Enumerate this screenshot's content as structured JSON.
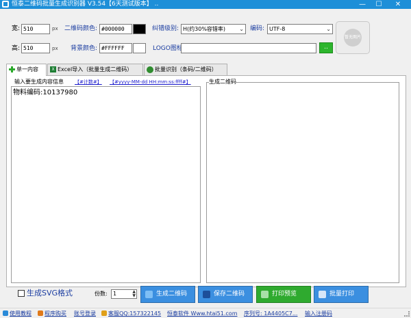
{
  "window": {
    "title": "恒泰二维码批量生成识别器 V3.54【6天测试版本】",
    "title_suffix": "..",
    "minimize": "—",
    "maximize": "☐",
    "close": "✕"
  },
  "settings": {
    "width_label": "宽:",
    "width_value": "510",
    "height_label": "高:",
    "height_value": "510",
    "unit": "px",
    "qr_color_label": "二维码颜色:",
    "qr_color_value": "#000000",
    "qr_color_swatch": "#000000",
    "bg_color_label": "背景颜色:",
    "bg_color_value": "#FFFFFF",
    "bg_color_swatch": "#FFFFFF",
    "ecc_label": "纠错级别:",
    "ecc_value": "H(约30%容错率)",
    "encoding_label": "编码:",
    "encoding_value": "UTF-8",
    "logo_label": "LOGO图标:",
    "logo_path": "",
    "browse_label": "..",
    "logo_placeholder": "暂无图片"
  },
  "tabs": [
    {
      "label": "单一内容",
      "icon": "plus-icon"
    },
    {
      "label": "Excel导入（批量生成二维码）",
      "icon": "excel-icon"
    },
    {
      "label": "批量识别（条码/二维码）",
      "icon": "scan-icon"
    }
  ],
  "content": {
    "input_label": "输入要生成内容信息",
    "token_counter": "【#计数#】",
    "token_datetime": "【#yyyy-MM-dd HH:mm:ss:ffff#】",
    "input_text": "物料编码:10137980",
    "output_label": "生成二维码"
  },
  "bottom": {
    "svg_label": "生成SVG格式",
    "count_label": "份数:",
    "count_value": "1",
    "generate_label": "生成二维码",
    "save_label": "保存二维码",
    "preview_label": "打印预览",
    "print_label": "批量打印"
  },
  "status": {
    "tutorial": "使用教程",
    "buy": "程序购买",
    "login": "账号登录",
    "qq": "客服QQ:157322145",
    "company": "恒泰软件 Www.htai51.com",
    "serial": "序列号: 1A4405C7...",
    "register": "输入注册码"
  },
  "colors": {
    "titlebar": "#1e8fd8",
    "button_blue": "#3b8fe0",
    "button_green": "#2faa2f",
    "link_blue": "#1a3ca0"
  }
}
